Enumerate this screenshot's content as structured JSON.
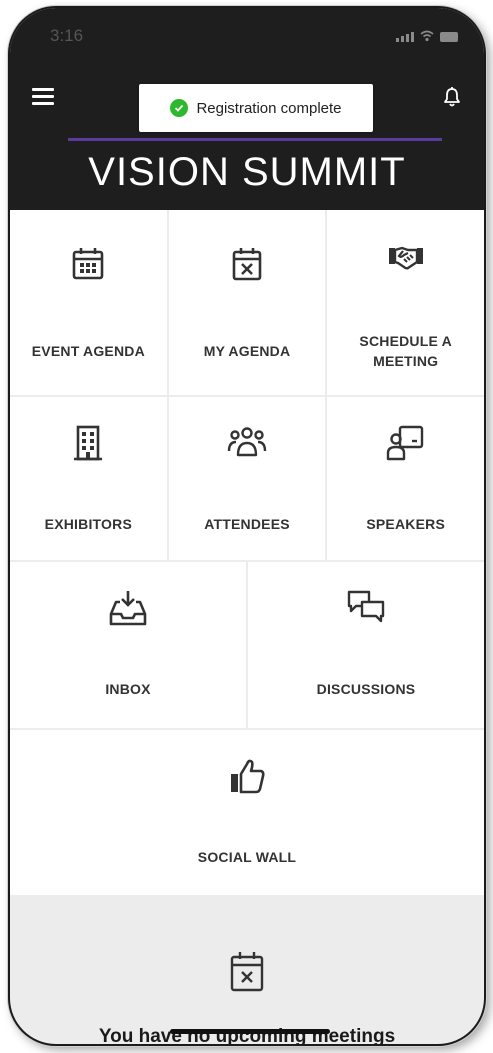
{
  "status_bar": {
    "time": "3:16"
  },
  "header": {
    "brand": "VISION SUMMIT",
    "toast_text": "Registration complete"
  },
  "tiles": [
    {
      "label": "EVENT AGENDA",
      "icon": "calendar-icon"
    },
    {
      "label": "MY AGENDA",
      "icon": "calendar-x-icon"
    },
    {
      "label": "SCHEDULE A MEETING",
      "icon": "handshake-icon"
    },
    {
      "label": "EXHIBITORS",
      "icon": "building-icon"
    },
    {
      "label": "ATTENDEES",
      "icon": "people-icon"
    },
    {
      "label": "SPEAKERS",
      "icon": "presenter-icon"
    },
    {
      "label": "INBOX",
      "icon": "inbox-download-icon"
    },
    {
      "label": "DISCUSSIONS",
      "icon": "chat-bubbles-icon"
    },
    {
      "label": "SOCIAL WALL",
      "icon": "thumbs-up-icon"
    }
  ],
  "meetings": {
    "empty_text": "You have no upcoming meetings"
  },
  "colors": {
    "header_bg": "#1e1e1e",
    "accent_line": "#5b3aa0",
    "success": "#2eb82e"
  }
}
